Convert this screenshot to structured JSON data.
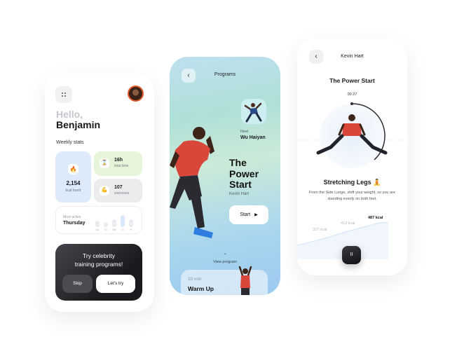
{
  "home": {
    "greeting": "Hello,",
    "user_name": "Benjamin",
    "weekly_stats_label": "Weekly stats",
    "kcal_value": "2,154",
    "kcal_label": "kcal burnt",
    "time_value": "16h",
    "time_label": "total time",
    "exercises_value": "107",
    "exercises_label": "exercises",
    "most_active_label": "Most active",
    "most_active_day": "Thursday",
    "activity_days": [
      "Mo",
      "Tu",
      "We",
      "Th",
      "Fr"
    ],
    "activity_levels": [
      0.45,
      0.35,
      0.55,
      0.85,
      0.55
    ],
    "promo_line1": "Try celebrity",
    "promo_line2": "training programs!",
    "skip_label": "Skip",
    "lets_try_label": "Let's try"
  },
  "programs": {
    "header_title": "Programs",
    "next_label": "Next",
    "next_name": "Wu Haiyan",
    "program_title_line1": "The",
    "program_title_line2": "Power",
    "program_title_line3": "Start",
    "coach": "Kevin Hart",
    "start_label": "Start",
    "view_program_label": "View program",
    "card_duration": "10 min",
    "card_title": "Warm Up"
  },
  "workout": {
    "header_title": "Kevin Hart",
    "title": "The Power Start",
    "timer": "00:27",
    "exercise_name": "Stretching Legs 🧘",
    "description": "From the Side Lunge, shift your weight, so you are standing evenly on both feet.",
    "chart_labels": [
      "327 kcal",
      "412 kcal",
      "487 kcal"
    ],
    "pause_label": "II"
  },
  "colors": {
    "accent_blue": "#dceafb",
    "accent_green": "#e6f4d9",
    "dark": "#1b1b1f"
  }
}
